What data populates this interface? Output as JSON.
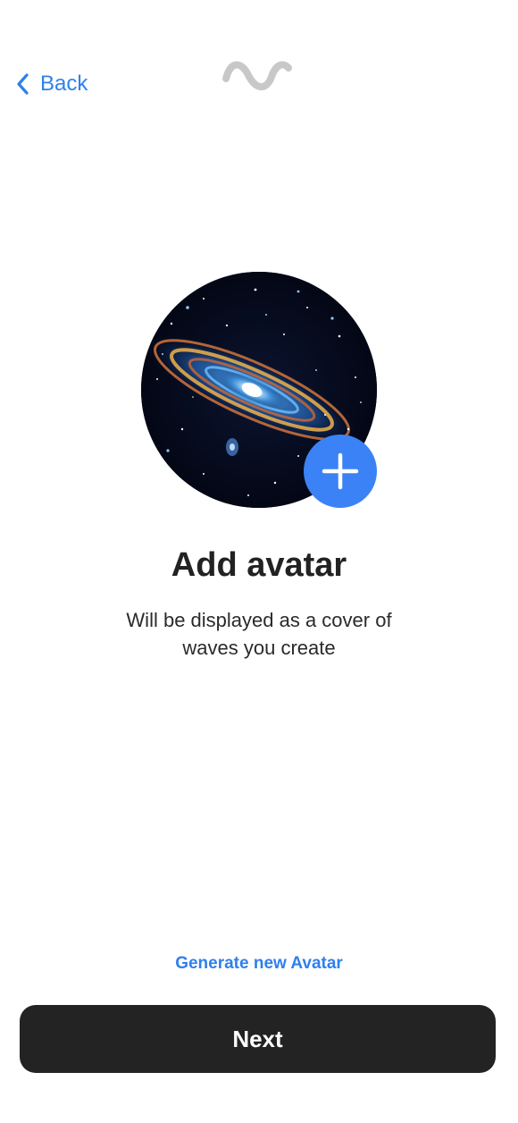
{
  "header": {
    "back_label": "Back"
  },
  "avatar": {
    "icon": "galaxy-image",
    "add_icon": "plus-icon"
  },
  "content": {
    "title": "Add avatar",
    "subtitle": "Will be displayed as a cover of waves you create"
  },
  "actions": {
    "generate_label": "Generate new Avatar",
    "next_label": "Next"
  },
  "colors": {
    "accent": "#2f80ed",
    "add_button": "#3b82f6",
    "primary_button": "#232323",
    "logo": "#c8c8c8"
  }
}
